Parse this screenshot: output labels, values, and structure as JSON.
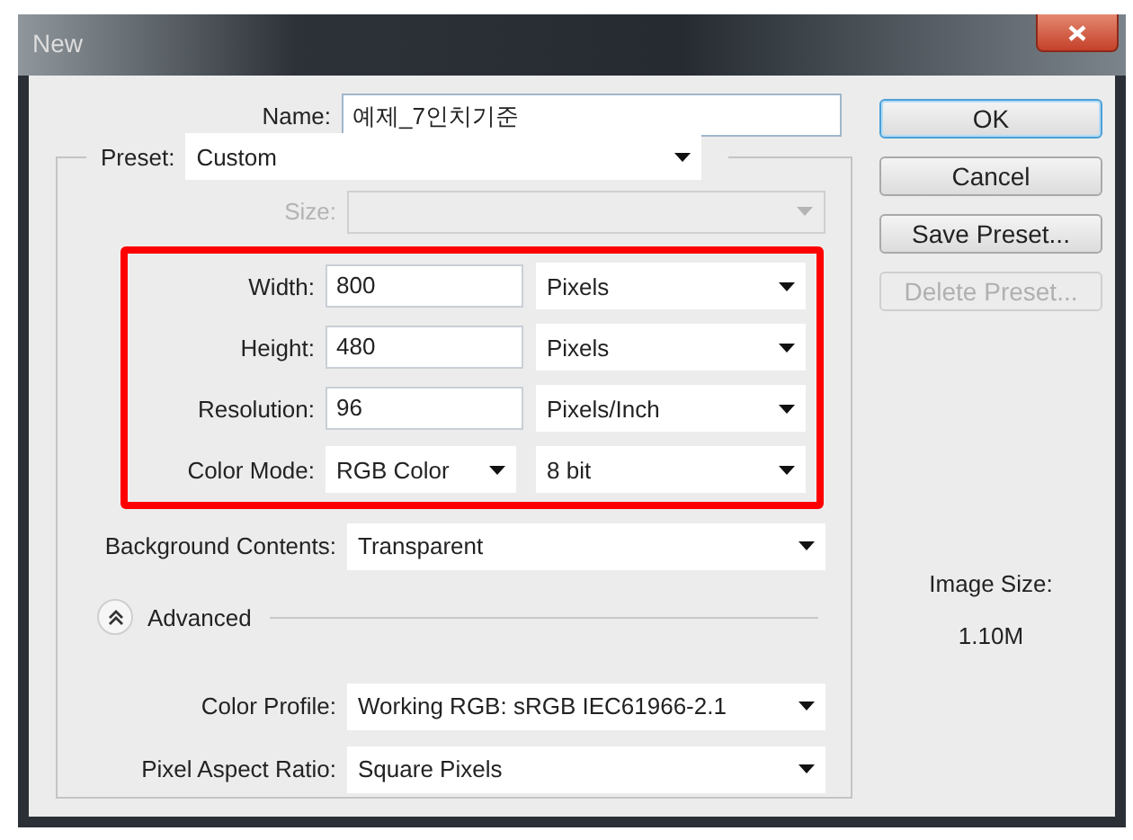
{
  "window": {
    "title": "New"
  },
  "name": {
    "label": "Name:",
    "value": "예제_7인치기준"
  },
  "preset": {
    "label": "Preset:",
    "value": "Custom"
  },
  "size": {
    "label": "Size:",
    "disabled": true
  },
  "highlighted_rows": [
    {
      "kind": "pair",
      "label": "Width:",
      "value": "800",
      "unit": "Pixels"
    },
    {
      "kind": "pair",
      "label": "Height:",
      "value": "480",
      "unit": "Pixels"
    },
    {
      "kind": "pair",
      "label": "Resolution:",
      "value": "96",
      "unit": "Pixels/Inch"
    },
    {
      "kind": "twoselect",
      "label": "Color Mode:",
      "value": "RGB Color",
      "unit": "8 bit"
    }
  ],
  "background_contents": {
    "label": "Background Contents:",
    "value": "Transparent"
  },
  "advanced": {
    "label": "Advanced",
    "expanded": true
  },
  "advanced_rows": [
    {
      "label": "Color Profile:",
      "value": "Working RGB:  sRGB IEC61966-2.1"
    },
    {
      "label": "Pixel Aspect Ratio:",
      "value": "Square Pixels"
    }
  ],
  "buttons": [
    {
      "label": "OK",
      "default": true,
      "disabled": false
    },
    {
      "label": "Cancel",
      "default": false,
      "disabled": false
    },
    {
      "label": "Save Preset...",
      "default": false,
      "disabled": false
    },
    {
      "label": "Delete Preset...",
      "default": false,
      "disabled": true
    }
  ],
  "image_size": {
    "label": "Image Size:",
    "value": "1.10M"
  }
}
